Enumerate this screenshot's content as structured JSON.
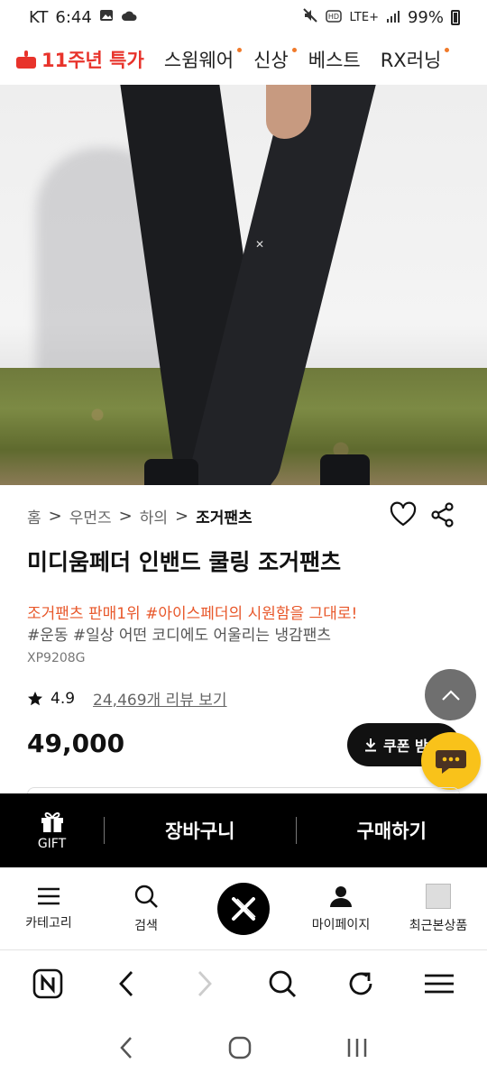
{
  "status_bar": {
    "carrier": "KT",
    "time": "6:44",
    "network": "LTE+",
    "battery": "99%"
  },
  "top_nav": {
    "promo_label": "11주년 특가",
    "items": [
      {
        "label": "스윔웨어",
        "has_dot": true
      },
      {
        "label": "신상",
        "has_dot": true
      },
      {
        "label": "베스트",
        "has_dot": false
      },
      {
        "label": "RX러닝",
        "has_dot": true
      }
    ]
  },
  "breadcrumb": {
    "items": [
      "홈",
      "우먼즈",
      "하의"
    ],
    "current": "조거팬츠",
    "separator": ">"
  },
  "product": {
    "title": "미디움페더 인밴드 쿨링 조거팬츠",
    "promo_text": "조거팬츠 판매1위 #아이스페더의 시원함을 그대로!",
    "hashtag_text": "#운동 #일상 어떤 코디에도 어울리는 냉감팬츠",
    "sku": "XP9208G",
    "rating": "4.9",
    "review_link": "24,469개 리뷰 보기",
    "price": "49,000",
    "coupon_label": "쿠폰 받"
  },
  "buy_bar": {
    "gift_label": "GIFT",
    "cart_label": "장바구니",
    "buy_label": "구매하기"
  },
  "tab_bar": {
    "category_label": "카테고리",
    "search_label": "검색",
    "mypage_label": "마이페이지",
    "recent_label": "최근본상품"
  },
  "colors": {
    "accent_red": "#e8332b",
    "promo_orange": "#e8582b",
    "chat_yellow": "#f9c21a"
  }
}
